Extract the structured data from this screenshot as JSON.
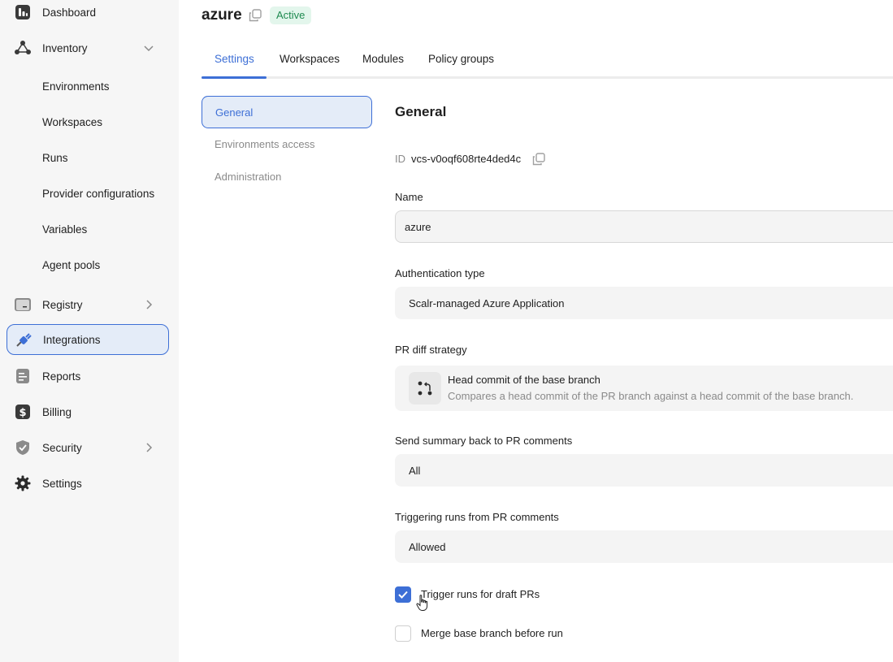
{
  "sidebar": {
    "items": [
      {
        "label": "Dashboard",
        "icon": "dashboard-icon"
      },
      {
        "label": "Inventory",
        "icon": "inventory-icon",
        "expanded": true
      },
      {
        "label": "Registry",
        "icon": "registry-icon"
      },
      {
        "label": "Integrations",
        "icon": "integrations-icon",
        "active": true
      },
      {
        "label": "Reports",
        "icon": "reports-icon"
      },
      {
        "label": "Billing",
        "icon": "billing-icon"
      },
      {
        "label": "Security",
        "icon": "security-icon"
      },
      {
        "label": "Settings",
        "icon": "gear-icon"
      }
    ],
    "inventory_sub": [
      "Environments",
      "Workspaces",
      "Runs",
      "Provider configurations",
      "Variables",
      "Agent pools"
    ]
  },
  "header": {
    "title": "azure",
    "status": "Active"
  },
  "tabs": [
    {
      "label": "Settings",
      "active": true
    },
    {
      "label": "Workspaces"
    },
    {
      "label": "Modules"
    },
    {
      "label": "Policy groups"
    }
  ],
  "settings_menu": [
    {
      "label": "General",
      "active": true
    },
    {
      "label": "Environments access"
    },
    {
      "label": "Administration"
    }
  ],
  "form": {
    "section_title": "General",
    "id_label": "ID",
    "id_value": "vcs-v0oqf608rte4ded4c",
    "name_label": "Name",
    "name_value": "azure",
    "auth_label": "Authentication type",
    "auth_value": "Scalr-managed Azure Application",
    "pr_diff_label": "PR diff strategy",
    "pr_diff_title": "Head commit of the base branch",
    "pr_diff_desc": "Compares a head commit of the PR branch against a head commit of the base branch.",
    "summary_label": "Send summary back to PR comments",
    "summary_value": "All",
    "trigger_label": "Triggering runs from PR comments",
    "trigger_value": "Allowed",
    "draft_label": "Trigger runs for draft PRs",
    "draft_checked": true,
    "merge_label": "Merge base branch before run",
    "merge_checked": false
  },
  "colors": {
    "accent": "#3d6fd6",
    "active_badge_bg": "#e3f6ec",
    "active_badge_text": "#1f8a50",
    "sidebar_bg": "#f6f6f6"
  }
}
